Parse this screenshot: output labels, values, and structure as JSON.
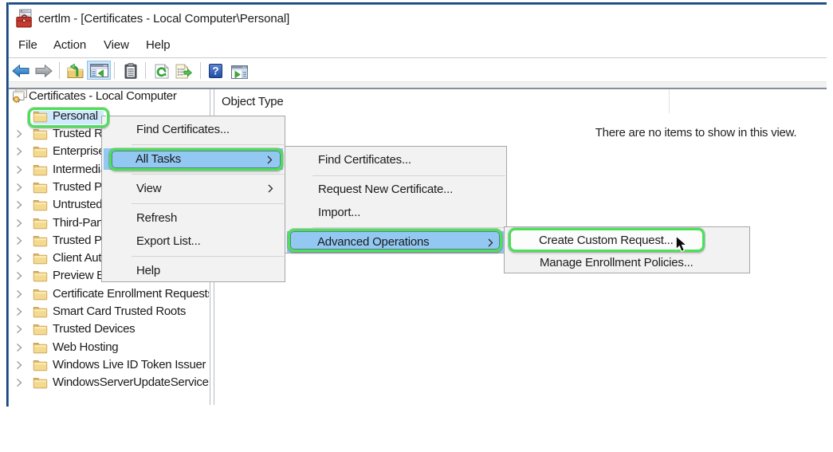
{
  "window": {
    "title": "certlm - [Certificates - Local Computer\\Personal]"
  },
  "menubar": {
    "items": [
      "File",
      "Action",
      "View",
      "Help"
    ]
  },
  "toolbar": {
    "buttons": [
      "back",
      "forward",
      "up-one-level",
      "show-console-tree",
      "clipboard",
      "refresh",
      "export-list",
      "help",
      "show-action-pane"
    ]
  },
  "tree": {
    "root": "Certificates - Local Computer",
    "items": [
      "Personal",
      "Trusted Root Certification Authorities",
      "Enterprise Trust",
      "Intermediate Certification Authorities",
      "Trusted Publishers",
      "Untrusted Certificates",
      "Third-Party Root Certification Authorities",
      "Trusted People",
      "Client Authentication Issuers",
      "Preview Build Roots",
      "Certificate Enrollment Requests",
      "Smart Card Trusted Roots",
      "Trusted Devices",
      "Web Hosting",
      "Windows Live ID Token Issuer",
      "WindowsServerUpdateServices"
    ]
  },
  "list": {
    "column_header": "Object Type",
    "empty_text": "There are no items to show in this view."
  },
  "context_menu": {
    "items": [
      "Find Certificates...",
      "All Tasks",
      "View",
      "Refresh",
      "Export List...",
      "Help"
    ]
  },
  "all_tasks_menu": {
    "items": [
      "Find Certificates...",
      "Request New Certificate...",
      "Import...",
      "Advanced Operations"
    ]
  },
  "advanced_operations_menu": {
    "items": [
      "Create Custom Request...",
      "Manage Enrollment Policies..."
    ]
  },
  "annotation": {
    "color": "#43d957",
    "highlighted": [
      "Personal",
      "All Tasks",
      "Advanced Operations",
      "Create Custom Request..."
    ]
  }
}
